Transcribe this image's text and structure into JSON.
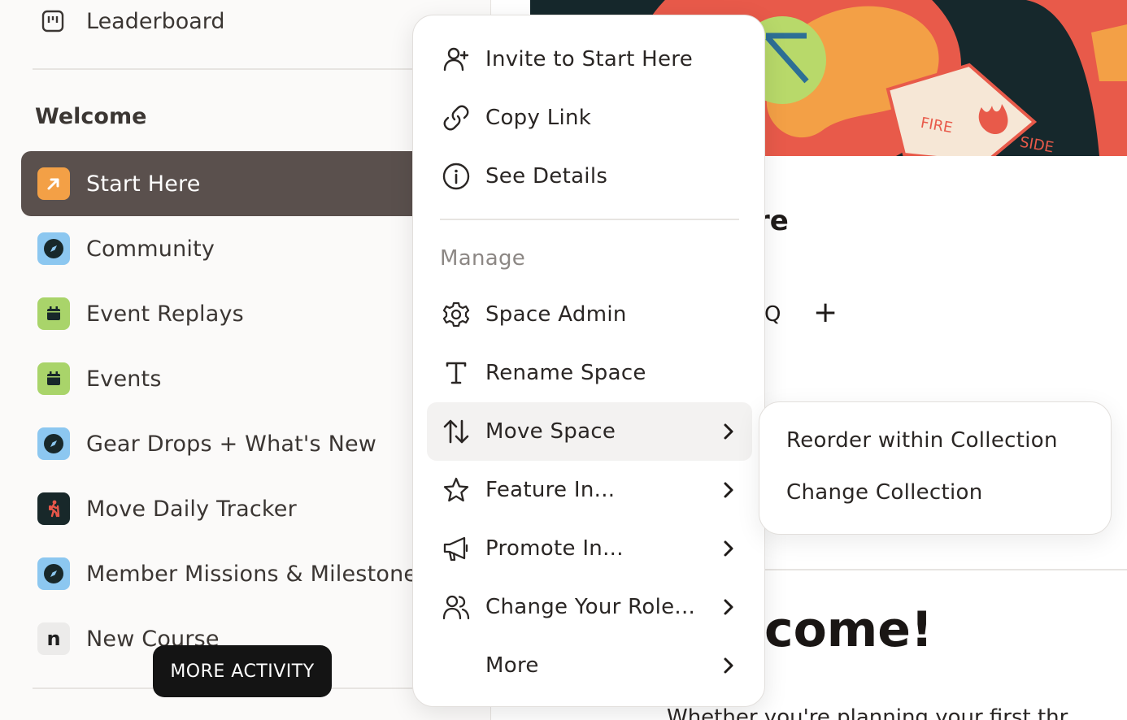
{
  "sidebar": {
    "leaderboard_label": "Leaderboard",
    "section_title": "Welcome",
    "items": [
      {
        "label": "Start Here",
        "icon": "arrow-up-right-icon",
        "color": "#f3a046",
        "active": true
      },
      {
        "label": "Community",
        "icon": "compass-icon",
        "color": "#8cc7f0"
      },
      {
        "label": "Event Replays",
        "icon": "calendar-icon",
        "color": "#a9d46a"
      },
      {
        "label": "Events",
        "icon": "calendar-icon",
        "color": "#a9d46a"
      },
      {
        "label": "Gear Drops + What's New",
        "icon": "compass-icon",
        "color": "#8cc7f0"
      },
      {
        "label": "Move Daily Tracker",
        "icon": "hiker-icon",
        "color": "#18282a"
      },
      {
        "label": "Member Missions & Milestones",
        "icon": "compass-icon",
        "color": "#8cc7f0"
      },
      {
        "label": "New Course",
        "icon": "letter-n-icon",
        "letter": "n"
      }
    ],
    "more_activity": "MORE ACTIVITY"
  },
  "main": {
    "hero_badge_top": "FIRE",
    "hero_badge_bottom": "SIDE",
    "title_fragment": "re",
    "tab_fragment": "Q",
    "add_symbol": "+",
    "welcome_fragment": "come!",
    "sub_fragment": "Whether you're planning your first thr"
  },
  "menu": {
    "items": [
      {
        "label": "Invite to Start Here",
        "icon": "user-plus-icon"
      },
      {
        "label": "Copy Link",
        "icon": "link-icon"
      },
      {
        "label": "See Details",
        "icon": "info-icon"
      }
    ],
    "manage_title": "Manage",
    "manage_items": [
      {
        "label": "Space Admin",
        "icon": "gear-icon"
      },
      {
        "label": "Rename Space",
        "icon": "text-icon"
      },
      {
        "label": "Move Space",
        "icon": "arrows-updown-icon",
        "submenu": true,
        "highlighted": true
      },
      {
        "label": "Feature In...",
        "icon": "star-icon",
        "submenu": true
      },
      {
        "label": "Promote In...",
        "icon": "megaphone-icon",
        "submenu": true
      },
      {
        "label": "Change Your Role...",
        "icon": "users-icon",
        "submenu": true
      },
      {
        "label": "More",
        "submenu": true
      }
    ]
  },
  "submenu": {
    "items": [
      "Reorder within Collection",
      "Change Collection"
    ]
  },
  "colors": {
    "active_bg": "#5a504d",
    "accent_orange": "#f3a046",
    "hero_bg": "#16282c"
  }
}
